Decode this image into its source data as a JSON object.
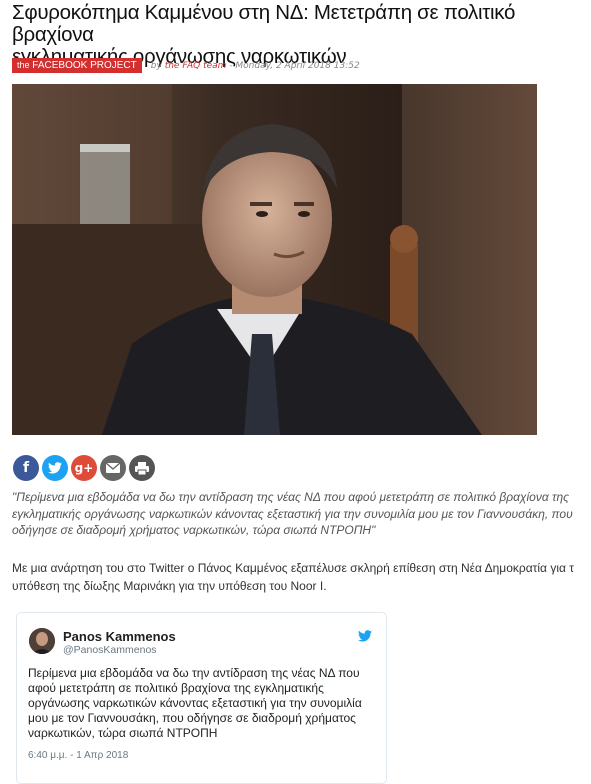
{
  "article": {
    "title_line1": "Σφυροκόπημα Καμμένου στη ΝΔ: Μετετράπη σε πολιτικό βραχίονα",
    "title_line2": "εγκληματικής οργάνωσης ναρκωτικών",
    "category_prefix": "the",
    "category": "FACEBOOK PROJECT",
    "byline_by": "by",
    "author": "the FAQ team",
    "date": "- Monday, 2 April 2018 13:52"
  },
  "share": {
    "facebook_icon": "f",
    "twitter_icon": "t",
    "googleplus_icon": "g+",
    "email_icon": "envelope",
    "print_icon": "printer"
  },
  "quote": {
    "line1": "\"Περίμενα μια εβδομάδα να δω την αντίδραση της νέας ΝΔ που αφού μετετράπη σε πολιτικό βραχίονα της",
    "line2": "εγκληματικής οργάνωσης ναρκωτικών κάνοντας εξεταστική για την συνομιλία μου με τον Γιαννουσάκη, που",
    "line3": "οδήγησε σε διαδρομή χρήματος ναρκωτικών, τώρα σιωπά ΝΤΡΟΠΗ\""
  },
  "body": {
    "line1": "Με μια ανάρτηση του στο Twitter ο Πάνος Καμμένος εξαπέλυσε σκληρή επίθεση στη Νέα Δημοκρατία για τ",
    "line2": "υπόθεση της δίωξης Μαρινάκη για την υπόθεση του Noor I."
  },
  "tweet": {
    "name": "Panos Kammenos",
    "handle": "@PanosKammenos",
    "line1": "Περίμενα μια εβδομάδα να δω την αντίδραση της νέας ΝΔ που",
    "line2": "αφού μετετράπη σε πολιτικό βραχίονα της εγκληματικής",
    "line3": "οργάνωσης ναρκωτικών κάνοντας εξεταστική για την συνομιλία",
    "line4": "μου με τον Γιαννουσάκη, που οδήγησε σε διαδρομή χρήματος",
    "line5": "ναρκωτικών, τώρα σιωπά ΝΤΡΟΠΗ",
    "time": "6:40 μ.μ. - 1 Απρ 2018"
  },
  "colors": {
    "accent_red": "#d32f2f",
    "facebook": "#3b5998",
    "twitter": "#1da1f2",
    "googleplus": "#dd4b39"
  }
}
